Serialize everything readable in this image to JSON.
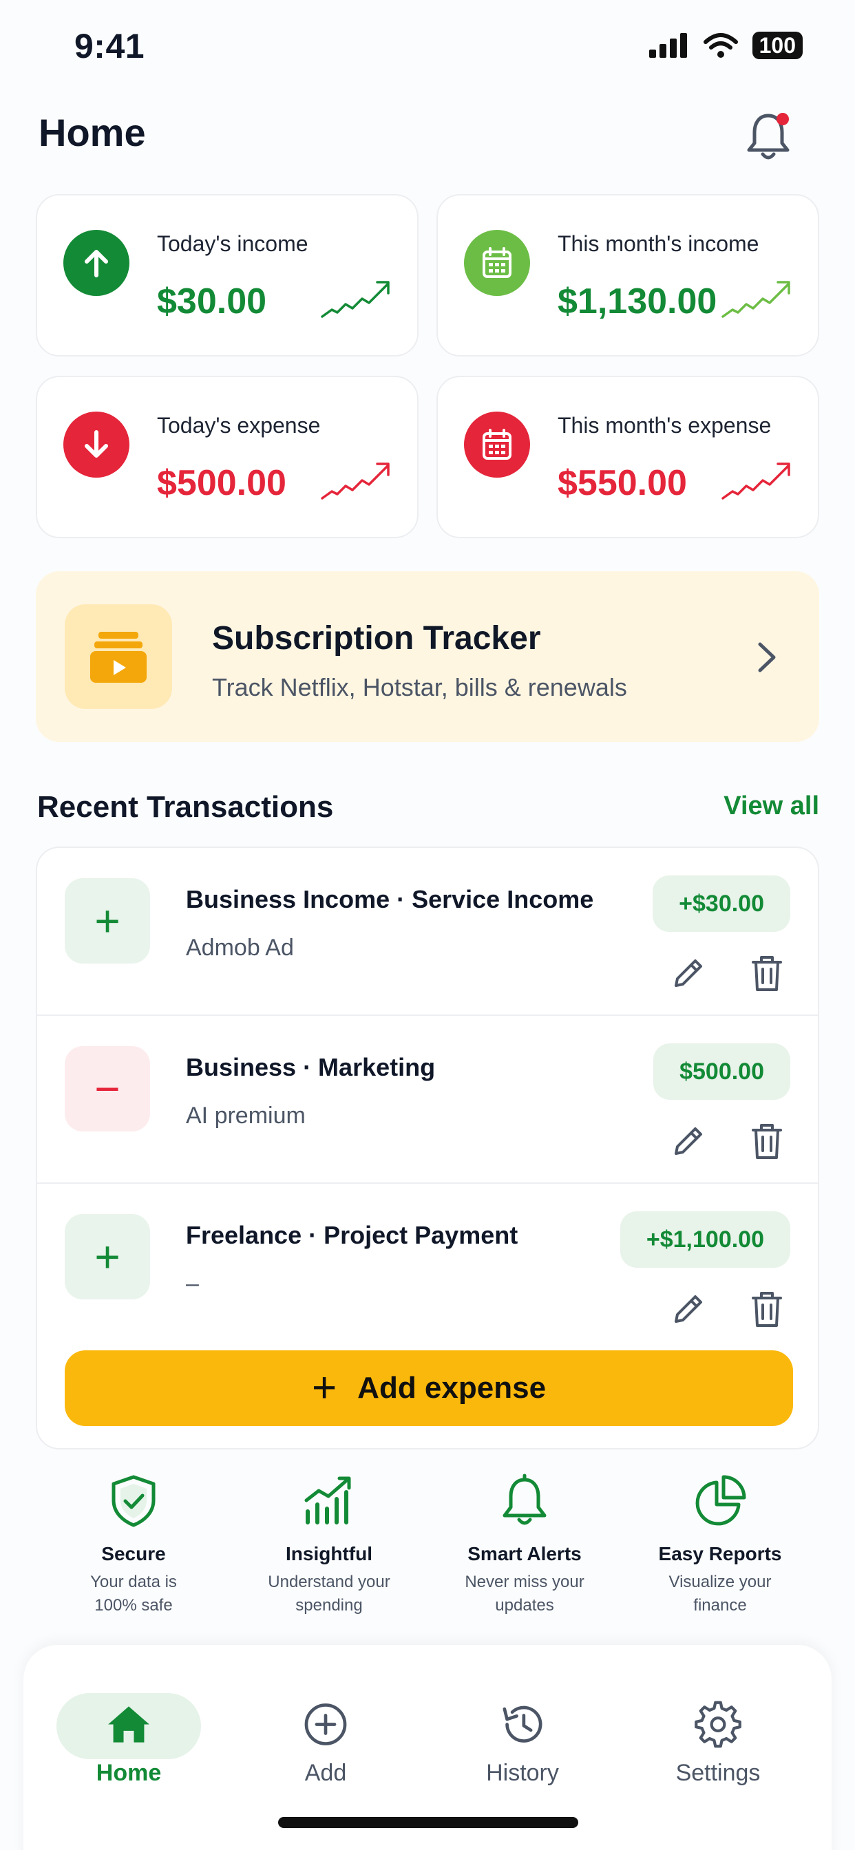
{
  "status_bar": {
    "time": "9:41",
    "battery": "100"
  },
  "header": {
    "title": "Home"
  },
  "stats": [
    {
      "label": "Today's income",
      "amount": "$30.00",
      "kind": "income",
      "icon": "arrow-up-icon"
    },
    {
      "label": "This month's income",
      "amount": "$1,130.00",
      "kind": "income",
      "icon": "calendar-icon"
    },
    {
      "label": "Today's expense",
      "amount": "$500.00",
      "kind": "expense",
      "icon": "arrow-down-icon"
    },
    {
      "label": "This month's expense",
      "amount": "$550.00",
      "kind": "expense",
      "icon": "calendar-icon"
    }
  ],
  "subscription": {
    "title": "Subscription Tracker",
    "description": "Track Netflix, Hotstar, bills & renewals"
  },
  "recent": {
    "title": "Recent Transactions",
    "view_all": "View all",
    "transactions": [
      {
        "title": "Business Income · Service Income",
        "subtitle": "Admob Ad",
        "amount": "+$30.00",
        "type": "income"
      },
      {
        "title": "Business · Marketing",
        "subtitle": "AI premium",
        "amount": "$500.00",
        "type": "expense"
      },
      {
        "title": "Freelance · Project Payment",
        "subtitle": "–",
        "amount": "+$1,100.00",
        "type": "income"
      }
    ],
    "add_button": "Add expense"
  },
  "features": [
    {
      "title": "Secure",
      "line1": "Your data is",
      "line2": "100% safe",
      "icon": "shield-check-icon"
    },
    {
      "title": "Insightful",
      "line1": "Understand your",
      "line2": "spending",
      "icon": "bar-chart-icon"
    },
    {
      "title": "Smart Alerts",
      "line1": "Never miss your",
      "line2": "updates",
      "icon": "bell-icon"
    },
    {
      "title": "Easy Reports",
      "line1": "Visualize your",
      "line2": "finance",
      "icon": "pie-chart-icon"
    }
  ],
  "nav": [
    {
      "label": "Home",
      "icon": "home-icon",
      "active": true
    },
    {
      "label": "Add",
      "icon": "plus-circle-icon",
      "active": false
    },
    {
      "label": "History",
      "icon": "history-icon",
      "active": false
    },
    {
      "label": "Settings",
      "icon": "gear-icon",
      "active": false
    }
  ],
  "colors": {
    "green": "#138a36",
    "light_green": "#6cbd45",
    "red": "#e5253a",
    "accent_yellow": "#fbb80c"
  }
}
